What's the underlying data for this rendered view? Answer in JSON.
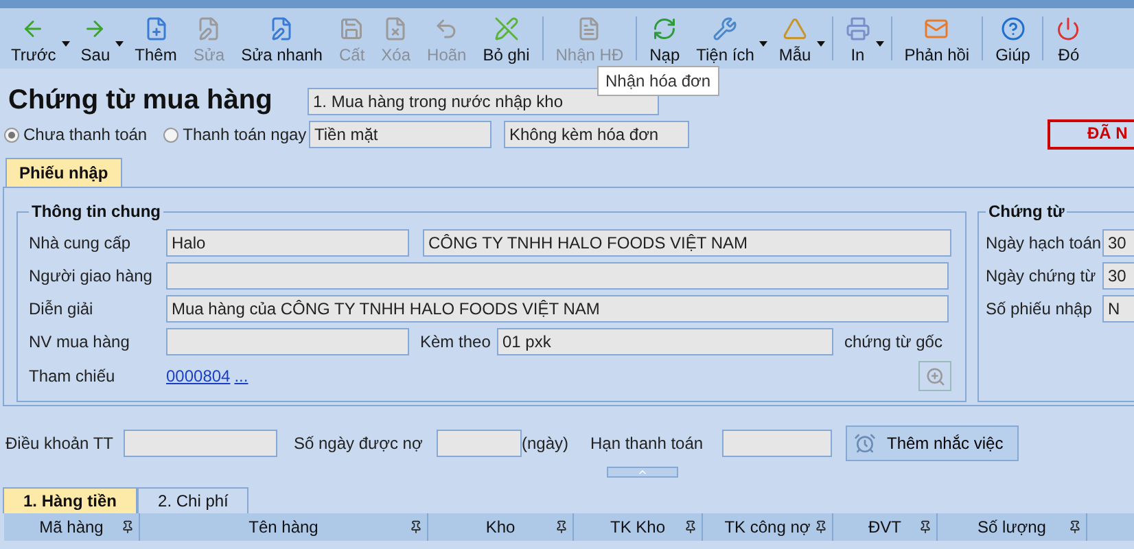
{
  "toolbar": {
    "buttons": [
      {
        "label": "Trước",
        "disabled": false,
        "dropdown": true
      },
      {
        "label": "Sau",
        "disabled": false,
        "dropdown": true
      },
      {
        "label": "Thêm",
        "disabled": false,
        "dropdown": false
      },
      {
        "label": "Sửa",
        "disabled": true,
        "dropdown": false
      },
      {
        "label": "Sửa nhanh",
        "disabled": false,
        "dropdown": false
      },
      {
        "label": "Cất",
        "disabled": true,
        "dropdown": false
      },
      {
        "label": "Xóa",
        "disabled": true,
        "dropdown": false
      },
      {
        "label": "Hoãn",
        "disabled": true,
        "dropdown": false
      },
      {
        "label": "Bỏ ghi",
        "disabled": false,
        "dropdown": false
      },
      {
        "label": "Nhận HĐ",
        "disabled": true,
        "dropdown": false
      },
      {
        "label": "Nạp",
        "disabled": false,
        "dropdown": false
      },
      {
        "label": "Tiện ích",
        "disabled": false,
        "dropdown": true
      },
      {
        "label": "Mẫu",
        "disabled": false,
        "dropdown": true
      },
      {
        "label": "In",
        "disabled": false,
        "dropdown": true
      },
      {
        "label": "Phản hồi",
        "disabled": false,
        "dropdown": false
      },
      {
        "label": "Giúp",
        "disabled": false,
        "dropdown": false
      },
      {
        "label": "Đó",
        "disabled": false,
        "dropdown": false
      }
    ],
    "tooltip": "Nhận hóa đơn"
  },
  "header": {
    "title": "Chứng từ mua hàng",
    "voucher_type": "1. Mua hàng trong nước nhập kho",
    "payment_options": [
      {
        "label": "Chưa thanh toán",
        "selected": true
      },
      {
        "label": "Thanh toán ngay",
        "selected": false
      }
    ],
    "payment_method": "Tiền mặt",
    "invoice_option": "Không kèm hóa đơn",
    "status_badge": "ĐÃ N"
  },
  "main_tab": {
    "label": "Phiếu nhập",
    "selected": true
  },
  "general_info": {
    "title": "Thông tin chung",
    "supplier_label": "Nhà cung cấp",
    "supplier_code": "Halo",
    "supplier_name": "CÔNG TY TNHH HALO FOODS VIỆT NAM",
    "deliverer_label": "Người giao hàng",
    "description_label": "Diễn giải",
    "description": "Mua hàng của CÔNG TY TNHH HALO FOODS VIỆT NAM",
    "buyer_label": "NV mua hàng",
    "attached_label": "Kèm theo",
    "attached_value": "01 pxk",
    "attached_suffix": "chứng từ gốc",
    "reference_label": "Tham chiếu",
    "reference_link": "0000804",
    "reference_more": "..."
  },
  "voucher_info": {
    "title": "Chứng từ",
    "rows": [
      {
        "label": "Ngày hạch toán",
        "value": "30"
      },
      {
        "label": "Ngày chứng từ",
        "value": "30"
      },
      {
        "label": "Số phiếu nhập",
        "value": "N"
      }
    ]
  },
  "payment_terms": {
    "terms_label": "Điều khoản TT",
    "days_label": "Số ngày được nợ",
    "days_unit": "(ngày)",
    "due_label": "Hạn thanh toán",
    "reminder_button": "Thêm nhắc việc"
  },
  "detail_tabs": [
    {
      "label": "1. Hàng tiền",
      "selected": true
    },
    {
      "label": "2. Chi phí",
      "selected": false
    }
  ],
  "table": {
    "columns": [
      "Mã hàng",
      "Tên hàng",
      "Kho",
      "TK Kho",
      "TK công nợ",
      "ĐVT",
      "Số lượng"
    ]
  }
}
